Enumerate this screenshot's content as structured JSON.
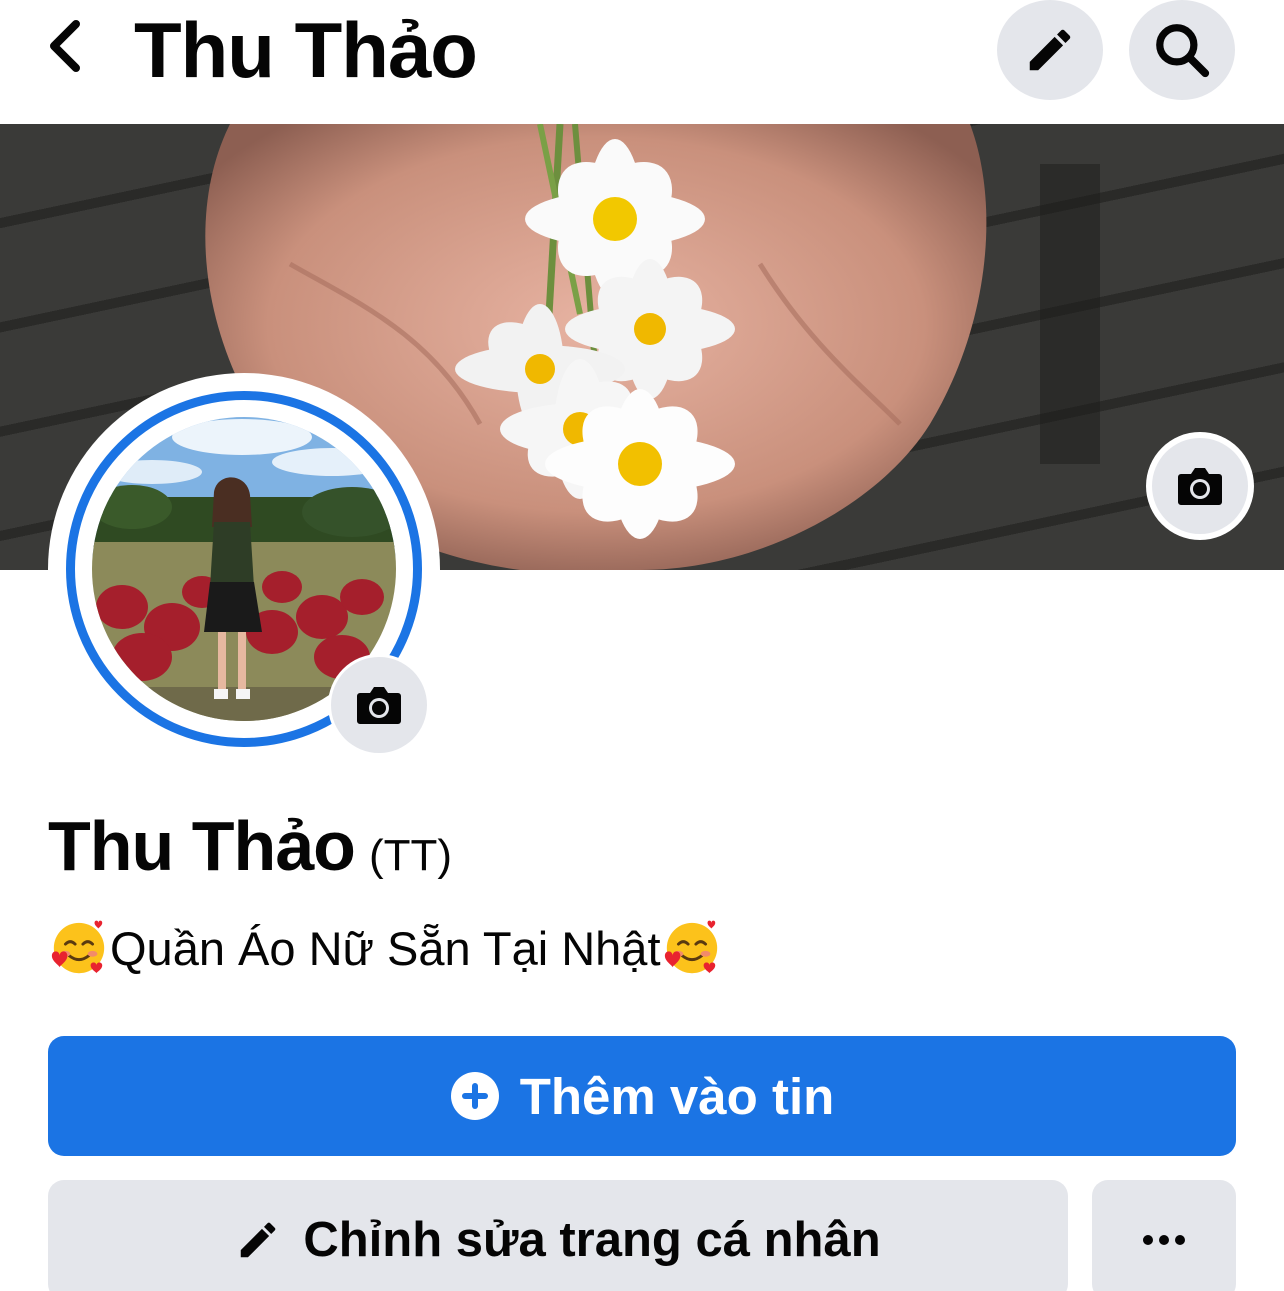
{
  "header": {
    "title": "Thu Thảo",
    "back_icon": "chevron-left-icon",
    "edit_icon": "pencil-icon",
    "search_icon": "search-icon"
  },
  "cover": {
    "camera_icon": "camera-icon"
  },
  "avatar": {
    "camera_icon": "camera-icon",
    "ring_color": "#1b74e4"
  },
  "profile": {
    "name": "Thu Thảo",
    "alternate_name": "(TT)",
    "bio": "Quần Áo Nữ Sẵn Tại Nhật",
    "bio_emoji": "smiling-face-with-hearts"
  },
  "actions": {
    "add_story_label": "Thêm vào tin",
    "add_story_icon": "plus-circle-icon",
    "edit_profile_label": "Chỉnh sửa trang cá nhân",
    "edit_profile_icon": "pencil-icon",
    "more_icon": "more-horizontal-icon"
  },
  "colors": {
    "primary": "#1b74e4",
    "secondary_button": "#e4e6eb",
    "text": "#050505"
  }
}
